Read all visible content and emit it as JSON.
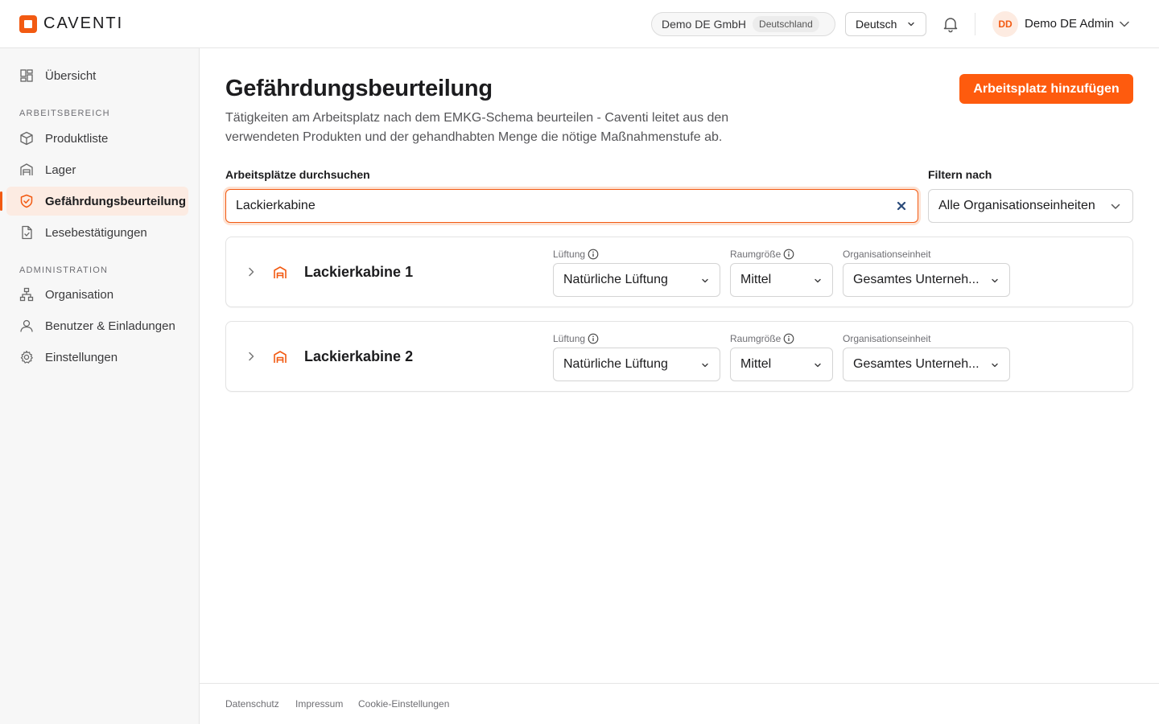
{
  "brand": {
    "name": "CAVENTI",
    "accent": "#f25a12"
  },
  "header": {
    "org_name": "Demo DE GmbH",
    "org_country": "Deutschland",
    "language": "Deutsch",
    "user_initials": "DD",
    "user_name": "Demo DE Admin"
  },
  "sidebar": {
    "overview": "Übersicht",
    "section_work": "ARBEITSBEREICH",
    "items_work": [
      {
        "label": "Produktliste",
        "icon": "cube-icon"
      },
      {
        "label": "Lager",
        "icon": "warehouse-icon"
      },
      {
        "label": "Gefährdungsbeurteilung",
        "icon": "shield-check-icon",
        "active": true
      },
      {
        "label": "Lesebestätigungen",
        "icon": "document-check-icon"
      }
    ],
    "section_admin": "ADMINISTRATION",
    "items_admin": [
      {
        "label": "Organisation",
        "icon": "org-chart-icon"
      },
      {
        "label": "Benutzer & Einladungen",
        "icon": "user-icon"
      },
      {
        "label": "Einstellungen",
        "icon": "gear-icon"
      }
    ]
  },
  "main": {
    "title": "Gefährdungsbeurteilung",
    "description": "Tätigkeiten am Arbeitsplatz nach dem EMKG-Schema beurteilen - Caventi leitet aus den verwendeten Produkten und der gehandhabten Menge die nötige Maßnahmenstufe ab.",
    "add_button": "Arbeitsplatz hinzufügen",
    "search_label": "Arbeitsplätze durchsuchen",
    "search_value": "Lackierkabine",
    "filter_label": "Filtern nach",
    "filter_value": "Alle Organisationseinheiten",
    "col_ventilation": "Lüftung",
    "col_room_size": "Raumgröße",
    "col_org_unit": "Organisationseinheit",
    "workplaces": [
      {
        "name": "Lackierkabine 1",
        "ventilation": "Natürliche Lüftung",
        "room_size": "Mittel",
        "org_unit": "Gesamtes Unterneh..."
      },
      {
        "name": "Lackierkabine 2",
        "ventilation": "Natürliche Lüftung",
        "room_size": "Mittel",
        "org_unit": "Gesamtes Unterneh..."
      }
    ]
  },
  "footer": {
    "privacy": "Datenschutz",
    "imprint": "Impressum",
    "cookies": "Cookie-Einstellungen"
  }
}
